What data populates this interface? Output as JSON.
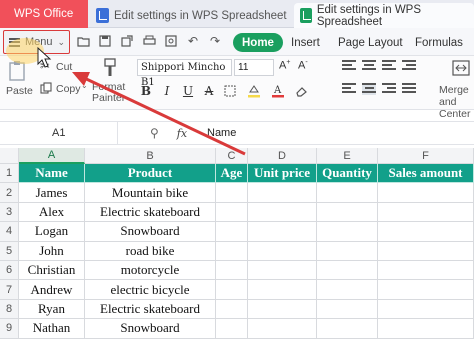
{
  "tabs": {
    "app": "WPS Office",
    "doc1": "Edit settings in WPS Spreadsheet",
    "doc2": "Edit settings in WPS Spreadsheet"
  },
  "menubar": {
    "menu_label": "Menu",
    "ribbon_tabs": [
      "Home",
      "Insert",
      "Page Layout",
      "Formulas"
    ],
    "active_tab": "Home"
  },
  "toolbar": {
    "cut": "Cut",
    "paste": "Paste",
    "copy": "Copy",
    "format_painter": "Format Painter",
    "font_name": "Shippori Mincho B1",
    "font_size": "11",
    "merge": "Merge and Center",
    "bold": "B",
    "italic": "I",
    "underline": "U"
  },
  "formulabar": {
    "cell_ref": "A1",
    "fx": "fx",
    "value": "Name"
  },
  "columns": [
    "A",
    "B",
    "C",
    "D",
    "E",
    "F"
  ],
  "rows": [
    "1",
    "2",
    "3",
    "4",
    "5",
    "6",
    "7",
    "8",
    "9"
  ],
  "table": {
    "headers": [
      "Name",
      "Product",
      "Age",
      "Unit price",
      "Quantity",
      "Sales amount"
    ],
    "data": [
      [
        "James",
        "Mountain bike"
      ],
      [
        "Alex",
        "Electric skateboard"
      ],
      [
        "Logan",
        "Snowboard"
      ],
      [
        "John",
        "road bike"
      ],
      [
        "Christian",
        "motorcycle"
      ],
      [
        "Andrew",
        "electric bicycle"
      ],
      [
        "Ryan",
        "Electric skateboard"
      ],
      [
        "Nathan",
        "Snowboard"
      ]
    ]
  },
  "colors": {
    "accent": "#1a9f5f",
    "header_fill": "#12a08a",
    "wps_tab": "#f1505a",
    "annotation": "#d93a3a"
  }
}
